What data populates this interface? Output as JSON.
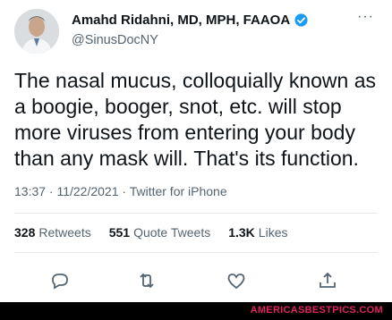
{
  "author": {
    "name": "Amahd Ridahni, MD, MPH, FAAOA",
    "handle": "@SinusDocNY"
  },
  "more_label": "···",
  "tweet": {
    "text": "The nasal mucus, colloquially known as a boogie, booger, snot, etc. will stop more viruses from entering your body than any mask will. That's its function.",
    "meta": "13:37 · 11/22/2021 · Twitter for iPhone"
  },
  "stats": [
    {
      "count": "328",
      "label": "Retweets"
    },
    {
      "count": "551",
      "label": "Quote Tweets"
    },
    {
      "count": "1.3K",
      "label": "Likes"
    }
  ],
  "actions": [
    "reply-icon",
    "retweet-icon",
    "like-icon",
    "share-icon"
  ],
  "footer": {
    "watermark": "AMERICASBESTPICS.COM"
  },
  "colors": {
    "verified": "#1d9bf0",
    "muted": "#536471",
    "watermark": "#e0245e"
  }
}
